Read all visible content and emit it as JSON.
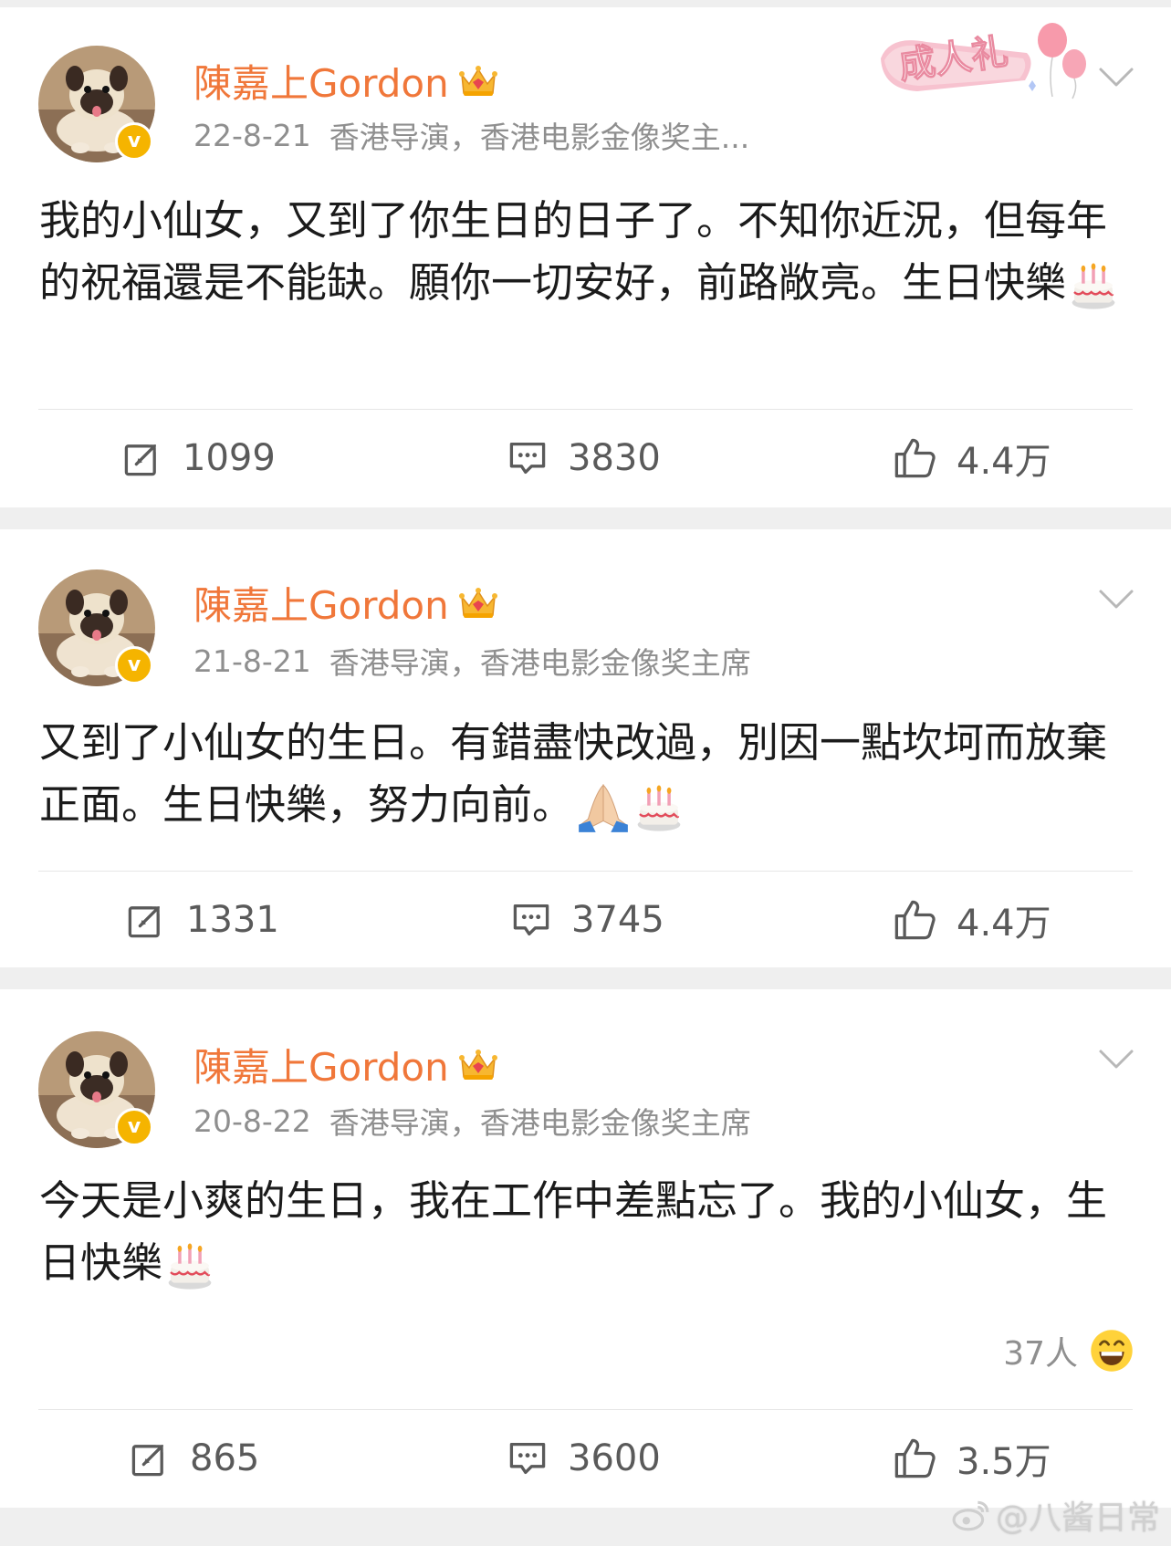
{
  "posts": [
    {
      "username": "陳嘉上Gordon",
      "date": "22-8-21",
      "bio": "香港导演，香港电影金像奖主...",
      "badge_text": "成人礼",
      "text": "我的小仙女，又到了你生日的日子了。不知你近況，但每年的祝福還是不能缺。願你一切安好，前路敞亮。生日快樂",
      "emojis": [
        "birthday-cake"
      ],
      "reposts": "1099",
      "comments": "3830",
      "likes": "4.4万"
    },
    {
      "username": "陳嘉上Gordon",
      "date": "21-8-21",
      "bio": "香港导演，香港电影金像奖主席",
      "text": "又到了小仙女的生日。有錯盡快改過，別因一點坎坷而放棄正面。生日快樂，努力向前。",
      "emojis": [
        "folded-hands",
        "birthday-cake"
      ],
      "reposts": "1331",
      "comments": "3745",
      "likes": "4.4万"
    },
    {
      "username": "陳嘉上Gordon",
      "date": "20-8-22",
      "bio": "香港导演，香港电影金像奖主席",
      "text": "今天是小爽的生日，我在工作中差點忘了。我的小仙女，生日快樂",
      "emojis": [
        "birthday-cake"
      ],
      "reaction_count": "37人",
      "reaction_icon": "grinning-face-icon",
      "reposts": "865",
      "comments": "3600",
      "likes": "3.5万"
    }
  ],
  "watermark": "@八酱日常",
  "colors": {
    "username": "#f0773a",
    "meta": "#8f8f8f",
    "text": "#1b1b1b",
    "action": "#5a5a5a",
    "background": "#efefef",
    "card": "#ffffff",
    "verified_badge": "#f5b400"
  }
}
